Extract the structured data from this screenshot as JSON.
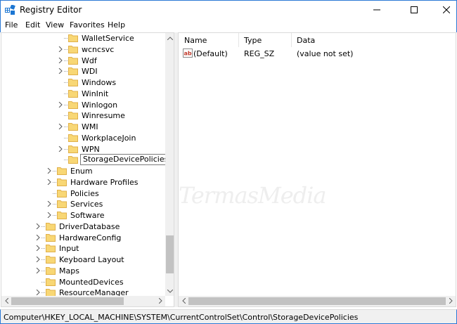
{
  "window": {
    "title": "Registry Editor"
  },
  "menu": [
    "File",
    "Edit",
    "View",
    "Favorites",
    "Help"
  ],
  "tree": [
    {
      "label": "WalletService",
      "level": 3,
      "expander": false,
      "selected": false
    },
    {
      "label": "wcncsvc",
      "level": 3,
      "expander": true,
      "selected": false
    },
    {
      "label": "Wdf",
      "level": 3,
      "expander": true,
      "selected": false
    },
    {
      "label": "WDI",
      "level": 3,
      "expander": true,
      "selected": false
    },
    {
      "label": "Windows",
      "level": 3,
      "expander": false,
      "selected": false
    },
    {
      "label": "WinInit",
      "level": 3,
      "expander": false,
      "selected": false
    },
    {
      "label": "Winlogon",
      "level": 3,
      "expander": true,
      "selected": false
    },
    {
      "label": "Winresume",
      "level": 3,
      "expander": false,
      "selected": false
    },
    {
      "label": "WMI",
      "level": 3,
      "expander": true,
      "selected": false
    },
    {
      "label": "WorkplaceJoin",
      "level": 3,
      "expander": false,
      "selected": false
    },
    {
      "label": "WPN",
      "level": 3,
      "expander": true,
      "selected": false
    },
    {
      "label": "StorageDevicePolicies",
      "level": 3,
      "expander": false,
      "selected": true
    },
    {
      "label": "Enum",
      "level": 2,
      "expander": true,
      "selected": false
    },
    {
      "label": "Hardware Profiles",
      "level": 2,
      "expander": true,
      "selected": false
    },
    {
      "label": "Policies",
      "level": 2,
      "expander": false,
      "selected": false
    },
    {
      "label": "Services",
      "level": 2,
      "expander": true,
      "selected": false
    },
    {
      "label": "Software",
      "level": 2,
      "expander": true,
      "selected": false
    },
    {
      "label": "DriverDatabase",
      "level": 1,
      "expander": true,
      "selected": false
    },
    {
      "label": "HardwareConfig",
      "level": 1,
      "expander": true,
      "selected": false
    },
    {
      "label": "Input",
      "level": 1,
      "expander": true,
      "selected": false
    },
    {
      "label": "Keyboard Layout",
      "level": 1,
      "expander": true,
      "selected": false
    },
    {
      "label": "Maps",
      "level": 1,
      "expander": true,
      "selected": false
    },
    {
      "label": "MountedDevices",
      "level": 1,
      "expander": false,
      "selected": false
    },
    {
      "label": "ResourceManager",
      "level": 1,
      "expander": true,
      "selected": false
    }
  ],
  "list": {
    "headers": {
      "name": "Name",
      "type": "Type",
      "data": "Data"
    },
    "rows": [
      {
        "name": "(Default)",
        "type": "REG_SZ",
        "data": "(value not set)"
      }
    ]
  },
  "watermark": "TermasMedia",
  "status": {
    "path": "Computer\\HKEY_LOCAL_MACHINE\\SYSTEM\\CurrentControlSet\\Control\\StorageDevicePolicies"
  },
  "colors": {
    "accent": "#2b79d6",
    "folder": "#f8d775",
    "folder_dark": "#e0b04a"
  }
}
